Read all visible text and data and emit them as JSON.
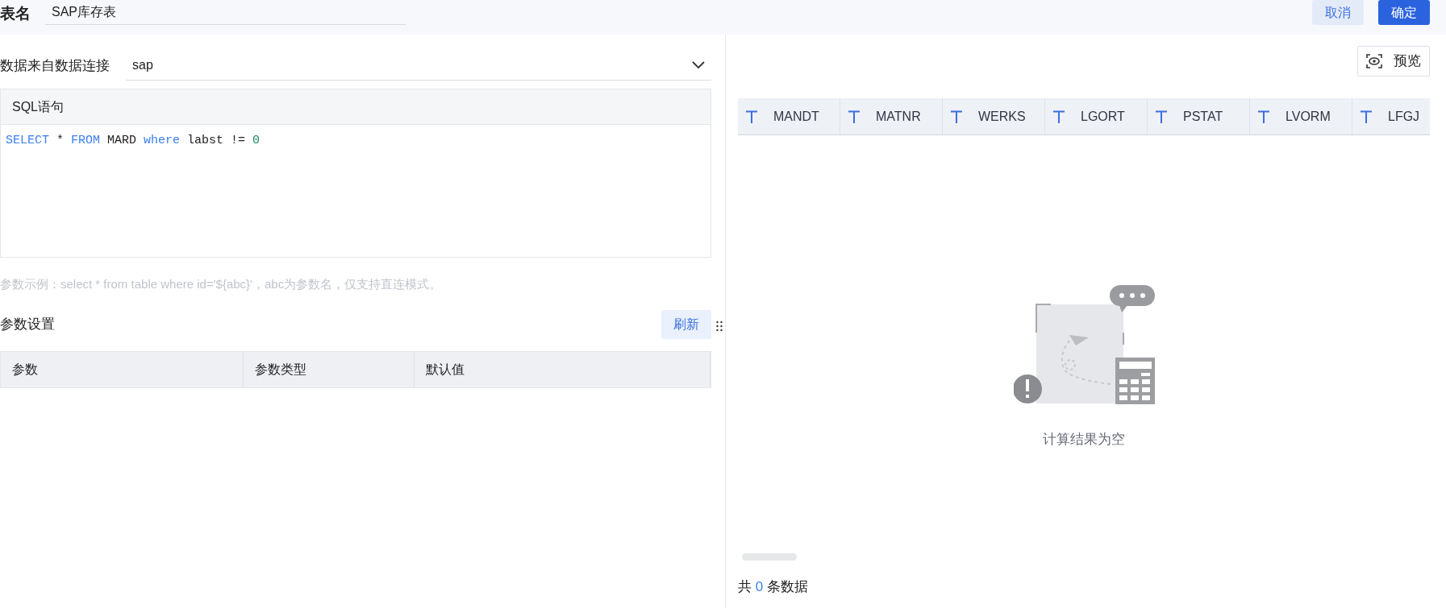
{
  "header": {
    "label": "表名",
    "table_name": "SAP库存表",
    "buttons": [
      {
        "label": "取消",
        "kind": "secondary"
      },
      {
        "label": "确定",
        "kind": "primary"
      }
    ]
  },
  "source": {
    "label": "数据来自数据连接",
    "value": "sap"
  },
  "sql": {
    "title": "SQL语句",
    "tokens": [
      {
        "text": "SELECT",
        "kind": "keyword"
      },
      {
        "text": " * ",
        "kind": "plain"
      },
      {
        "text": "FROM",
        "kind": "keyword"
      },
      {
        "text": " MARD ",
        "kind": "plain"
      },
      {
        "text": "where",
        "kind": "keyword"
      },
      {
        "text": " labst != ",
        "kind": "plain"
      },
      {
        "text": "0",
        "kind": "number"
      }
    ]
  },
  "hint": "参数示例：select * from table where id='${abc}'，abc为参数名，仅支持直连模式。",
  "params": {
    "title": "参数设置",
    "refresh": "刷新",
    "columns": [
      "参数",
      "参数类型",
      "默认值"
    ]
  },
  "preview": {
    "button": "预览",
    "columns": [
      "MANDT",
      "MATNR",
      "WERKS",
      "LGORT",
      "PSTAT",
      "LVORM",
      "LFGJ"
    ],
    "empty_text": "计算结果为空",
    "footer": {
      "prefix": "共",
      "count": "0",
      "suffix": "条数据"
    }
  }
}
